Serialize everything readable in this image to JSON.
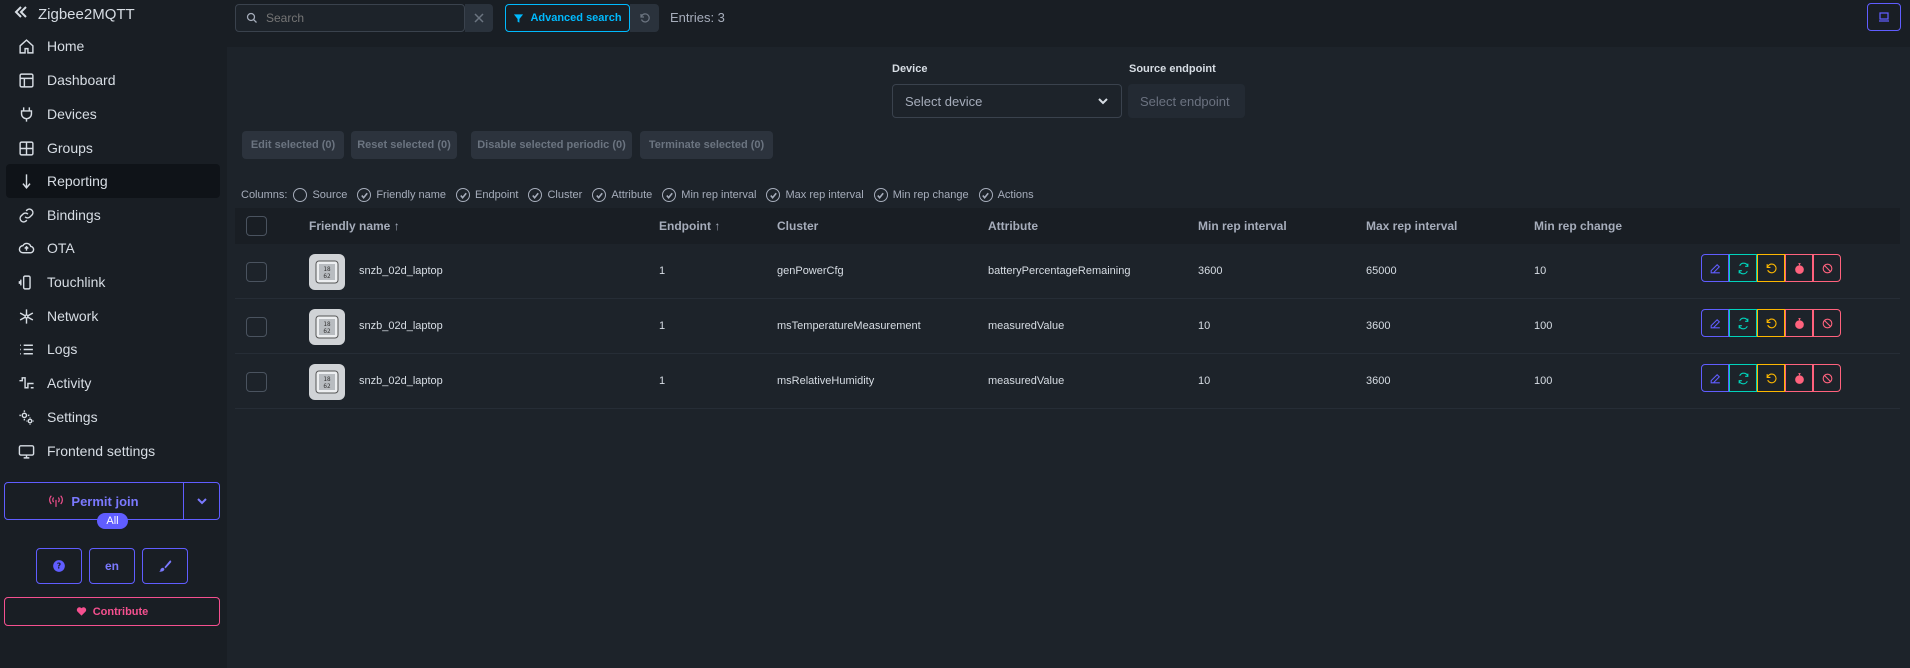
{
  "app": {
    "title": "Zigbee2MQTT"
  },
  "sidebar": {
    "items": [
      {
        "label": "Home",
        "icon": "home-icon"
      },
      {
        "label": "Dashboard",
        "icon": "dashboard-icon"
      },
      {
        "label": "Devices",
        "icon": "plug-icon"
      },
      {
        "label": "Groups",
        "icon": "grid-icon"
      },
      {
        "label": "Reporting",
        "icon": "arrow-down-icon",
        "active": true
      },
      {
        "label": "Bindings",
        "icon": "link-icon"
      },
      {
        "label": "OTA",
        "icon": "cloud-upload-icon"
      },
      {
        "label": "Touchlink",
        "icon": "touchlink-icon"
      },
      {
        "label": "Network",
        "icon": "network-icon"
      },
      {
        "label": "Logs",
        "icon": "list-icon"
      },
      {
        "label": "Activity",
        "icon": "activity-icon"
      },
      {
        "label": "Settings",
        "icon": "cogs-icon"
      },
      {
        "label": "Frontend settings",
        "icon": "monitor-icon"
      }
    ],
    "permit_join": "Permit join",
    "permit_badge": "All",
    "lang": "en",
    "contribute": "Contribute"
  },
  "toolbar": {
    "search_placeholder": "Search",
    "advanced_search": "Advanced search",
    "entries": "Entries: 3"
  },
  "filters": {
    "device_label": "Device",
    "device_placeholder": "Select device",
    "endpoint_label": "Source endpoint",
    "endpoint_placeholder": "Select endpoint"
  },
  "bulk_actions": [
    "Edit selected (0)",
    "Reset selected (0)",
    "Disable selected periodic (0)",
    "Terminate selected (0)"
  ],
  "columns_toggle": {
    "label": "Columns:",
    "items": [
      {
        "label": "Source",
        "checked": false
      },
      {
        "label": "Friendly name",
        "checked": true
      },
      {
        "label": "Endpoint",
        "checked": true
      },
      {
        "label": "Cluster",
        "checked": true
      },
      {
        "label": "Attribute",
        "checked": true
      },
      {
        "label": "Min rep interval",
        "checked": true
      },
      {
        "label": "Max rep interval",
        "checked": true
      },
      {
        "label": "Min rep change",
        "checked": true
      },
      {
        "label": "Actions",
        "checked": true
      }
    ]
  },
  "table": {
    "headers": {
      "friendly_name": "Friendly name ↑",
      "endpoint": "Endpoint ↑",
      "cluster": "Cluster",
      "attribute": "Attribute",
      "min_rep_interval": "Min rep interval",
      "max_rep_interval": "Max rep interval",
      "min_rep_change": "Min rep change"
    },
    "rows": [
      {
        "friendly_name": "snzb_02d_laptop",
        "endpoint": "1",
        "cluster": "genPowerCfg",
        "attribute": "batteryPercentageRemaining",
        "min_rep_interval": "3600",
        "max_rep_interval": "65000",
        "min_rep_change": "10"
      },
      {
        "friendly_name": "snzb_02d_laptop",
        "endpoint": "1",
        "cluster": "msTemperatureMeasurement",
        "attribute": "measuredValue",
        "min_rep_interval": "10",
        "max_rep_interval": "3600",
        "min_rep_change": "100"
      },
      {
        "friendly_name": "snzb_02d_laptop",
        "endpoint": "1",
        "cluster": "msRelativeHumidity",
        "attribute": "measuredValue",
        "min_rep_interval": "10",
        "max_rep_interval": "3600",
        "min_rep_change": "100"
      }
    ]
  },
  "colors": {
    "primary": "#605dff",
    "info": "#00bafe",
    "success": "#00d3bb",
    "warning": "#fcb700",
    "error": "#ff627d",
    "accent": "#f5508f"
  }
}
